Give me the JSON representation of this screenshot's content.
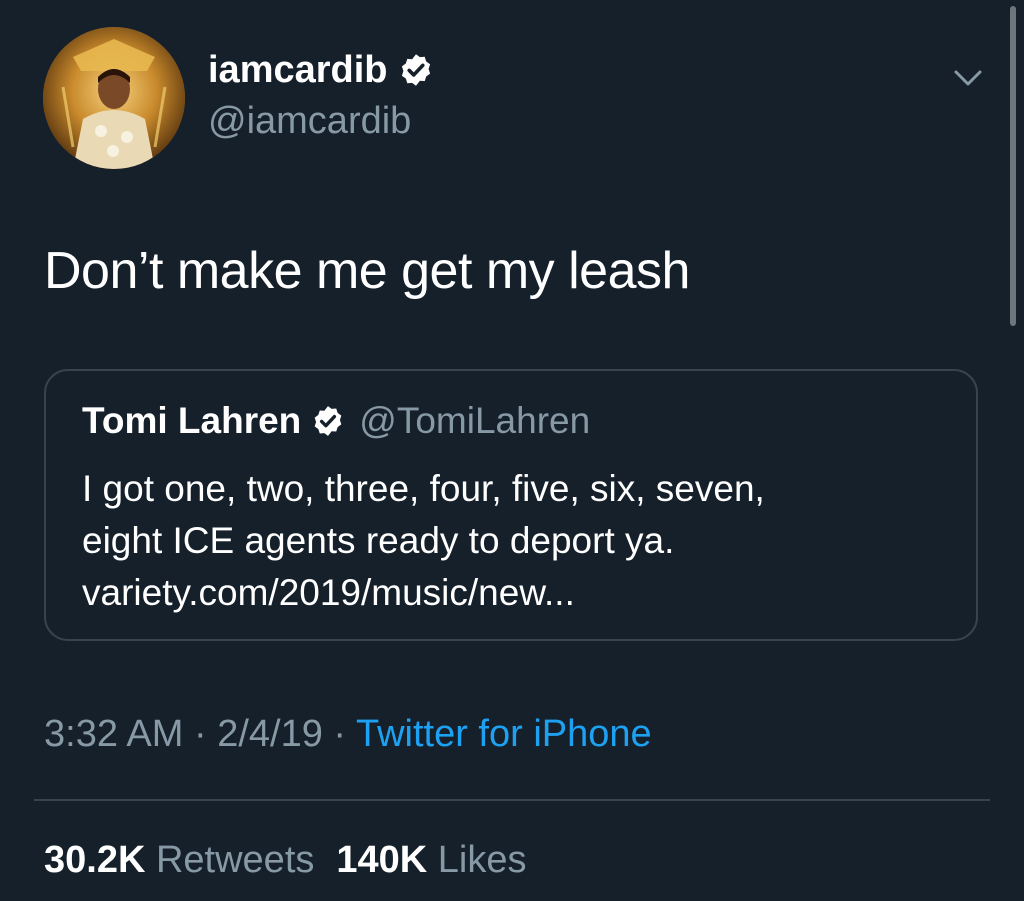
{
  "tweet": {
    "author": {
      "display_name": "iamcardib",
      "handle": "@iamcardib",
      "verified": true
    },
    "text": "Don’t make me get my leash",
    "quoted": {
      "display_name": "Tomi Lahren",
      "handle": "@TomiLahren",
      "verified": true,
      "lines": [
        "I got one, two, three, four, five, six, seven,",
        "eight ICE agents ready to deport ya.",
        "variety.com/2019/music/new..."
      ]
    },
    "meta": {
      "time": "3:32 AM",
      "separator": " · ",
      "date": "2/4/19",
      "source": "Twitter for iPhone"
    },
    "stats": {
      "retweets_count": "30.2K",
      "retweets_label": "Retweets",
      "likes_count": "140K",
      "likes_label": "Likes"
    }
  },
  "icons": {
    "verified": "verified-badge-icon",
    "more": "chevron-down-icon"
  },
  "colors": {
    "background": "#15202b",
    "text_primary": "#ffffff",
    "text_secondary": "#8899a6",
    "link": "#1da1f2",
    "border": "#38444d"
  }
}
